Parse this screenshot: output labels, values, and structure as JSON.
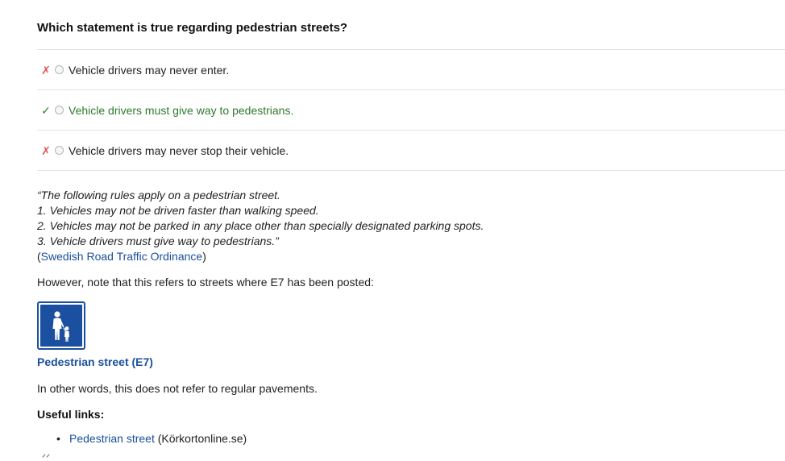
{
  "question": "Which statement is true regarding pedestrian streets?",
  "answers": [
    {
      "mark": "✗",
      "text": "Vehicle drivers may never enter.",
      "correct": false
    },
    {
      "mark": "✓",
      "text": "Vehicle drivers must give way to pedestrians.",
      "correct": true
    },
    {
      "mark": "✗",
      "text": "Vehicle drivers may never stop their vehicle.",
      "correct": false
    }
  ],
  "quote": {
    "lines": [
      "“The following rules apply on a pedestrian street.",
      "1. Vehicles may not be driven faster than walking speed.",
      "2. Vehicles may not be parked in any place other than specially designated parking spots.",
      "3. Vehicle drivers must give way to pedestrians.”"
    ],
    "source_open": "(",
    "source_link": "Swedish Road Traffic Ordinance",
    "source_close": ")"
  },
  "note": "However, note that this refers to streets where E7 has been posted:",
  "sign": {
    "icon": "pedestrian-street-sign-icon",
    "caption": "Pedestrian street (E7)",
    "color": "#1b4fa0"
  },
  "other_words": "In other words, this does not refer to regular pavements.",
  "useful_links_heading": "Useful links:",
  "useful_links": [
    {
      "bullet": "•",
      "link": "Pedestrian street",
      "suffix": " (Körkortonline.se)"
    }
  ],
  "colors": {
    "wrong": "#e05555",
    "right": "#2f8a2f",
    "link": "#1a4f9c"
  }
}
